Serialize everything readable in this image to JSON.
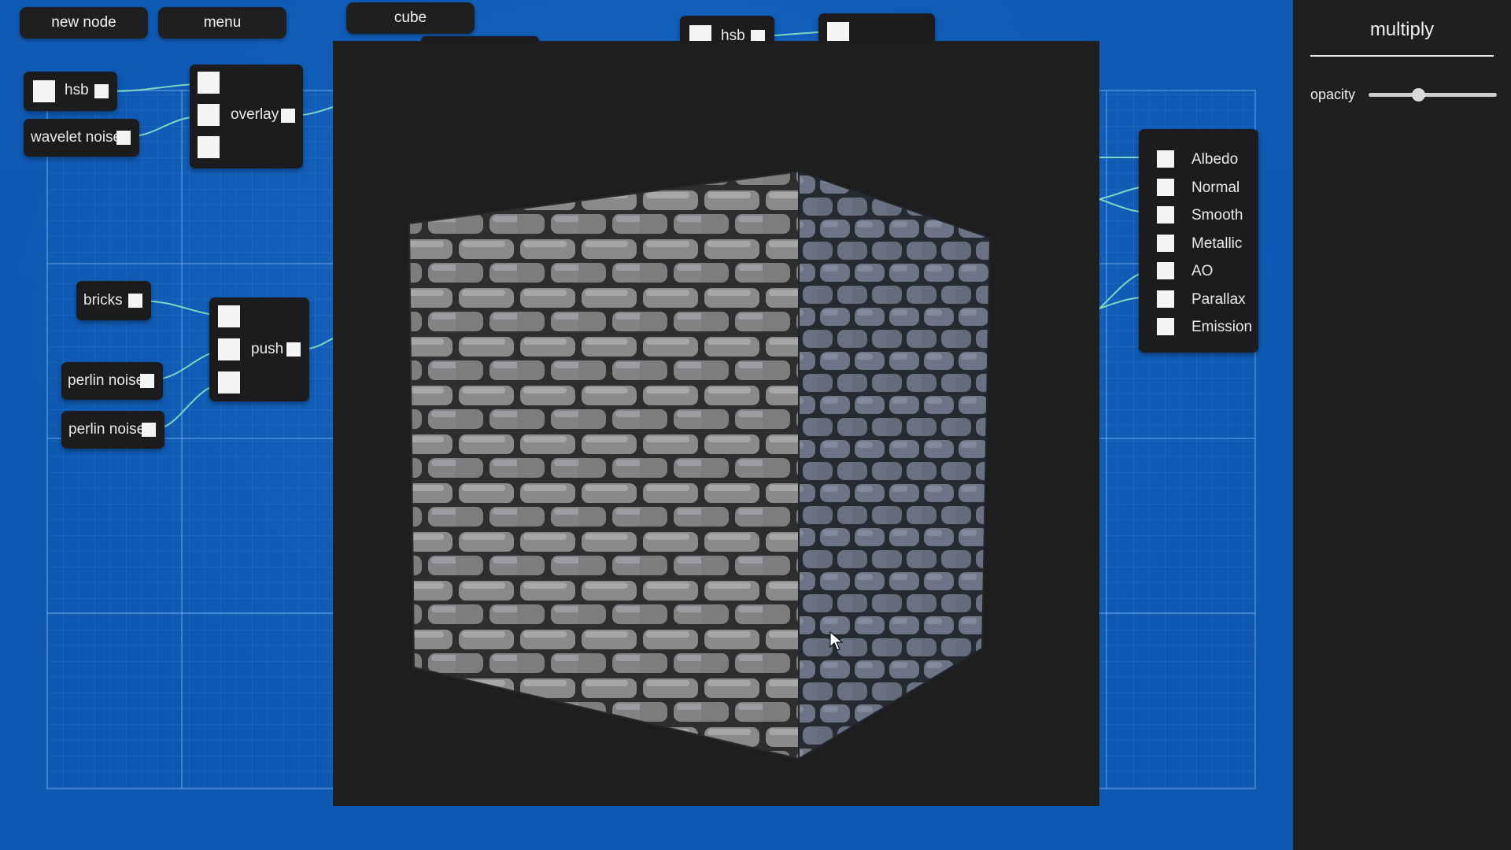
{
  "toolbar": {
    "new_node_label": "new node",
    "menu_label": "menu",
    "cube_label": "cube"
  },
  "nodes": {
    "hsb_left": "hsb",
    "wavelet_noise": "wavelet noise",
    "overlay": "overlay",
    "bricks": "bricks",
    "perlin_noise_1": "perlin noise",
    "perlin_noise_2": "perlin noise",
    "push": "push",
    "hsb_top": "hsb"
  },
  "output_node": {
    "channels": [
      "Albedo",
      "Normal",
      "Smooth",
      "Metallic",
      "AO",
      "Parallax",
      "Emission"
    ]
  },
  "panel": {
    "title": "multiply",
    "opacity_label": "opacity",
    "opacity_value": 0.38
  },
  "colors": {
    "canvas_blue": "#0f5ab4",
    "node_bg": "#1c1c1e",
    "wire": "#7fd6c4",
    "panel_bg": "#1f1f21"
  },
  "icons": {
    "cursor": "arrow-cursor-icon"
  }
}
